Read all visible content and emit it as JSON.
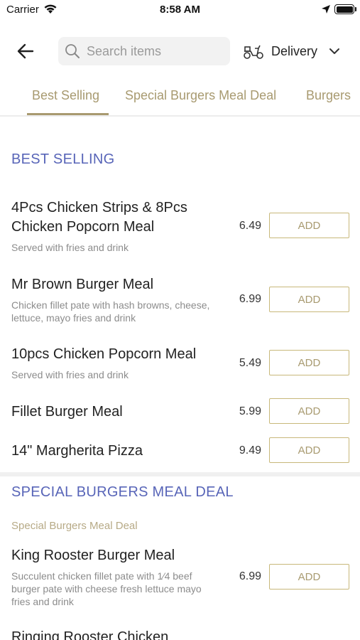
{
  "status_bar": {
    "carrier": "Carrier",
    "time": "8:58 AM"
  },
  "header": {
    "search_placeholder": "Search items",
    "delivery_label": "Delivery"
  },
  "tabs": [
    {
      "label": "Best Selling",
      "active": true
    },
    {
      "label": "Special Burgers Meal Deal",
      "active": false
    },
    {
      "label": "Burgers",
      "active": false
    }
  ],
  "sections": [
    {
      "title": "BEST SELLING",
      "items": [
        {
          "name": "4Pcs Chicken Strips & 8Pcs Chicken Popcorn Meal",
          "description": "Served with fries and drink",
          "price": "6.49",
          "button": "ADD"
        },
        {
          "name": "Mr Brown Burger Meal",
          "description": "Chicken fillet pate with hash browns, cheese, lettuce, mayo fries and drink",
          "price": "6.99",
          "button": "ADD"
        },
        {
          "name": "10pcs Chicken Popcorn Meal",
          "description": "Served with fries and drink",
          "price": "5.49",
          "button": "ADD"
        },
        {
          "name": "Fillet Burger Meal",
          "description": "",
          "price": "5.99",
          "button": "ADD"
        },
        {
          "name": "14\" Margherita Pizza",
          "description": "",
          "price": "9.49",
          "button": "ADD"
        }
      ]
    },
    {
      "title": "SPECIAL BURGERS MEAL DEAL",
      "subtitle": "Special Burgers Meal Deal",
      "items": [
        {
          "name": "King Rooster Burger Meal",
          "description": "Succulent chicken fillet pate with 1⁄4 beef burger pate with cheese fresh lettuce mayo fries and drink",
          "price": "6.99",
          "button": "ADD"
        },
        {
          "name": "Ringing Rooster Chicken",
          "description": "",
          "price": "",
          "button": ""
        }
      ]
    }
  ],
  "colors": {
    "accent_gold": "#a89a70",
    "section_blue": "#5865b8",
    "button_border": "#c8b87a"
  },
  "icons": [
    "wifi-icon",
    "location-arrow-icon",
    "battery-icon",
    "back-arrow-icon",
    "search-icon",
    "scooter-icon",
    "chevron-down-icon"
  ]
}
